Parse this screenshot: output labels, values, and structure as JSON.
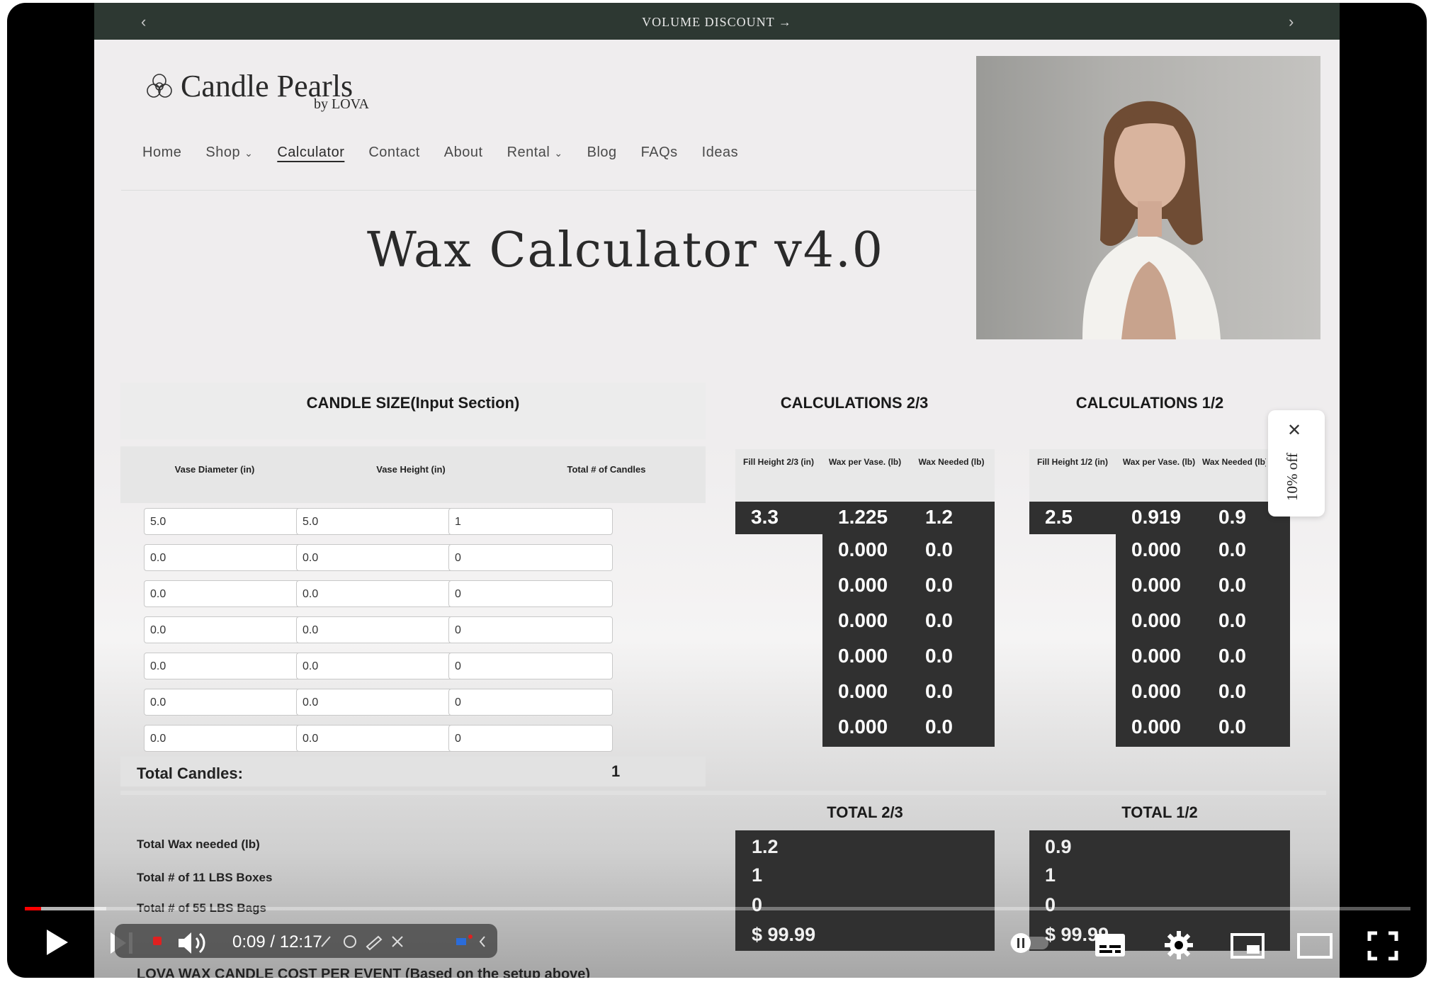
{
  "announcement": {
    "text": "VOLUME DISCOUNT →",
    "prev": "‹",
    "next": "›"
  },
  "logo": {
    "name": "Candle Pearls",
    "by": "by LOVA"
  },
  "nav": [
    {
      "label": "Home",
      "dropdown": false,
      "active": false
    },
    {
      "label": "Shop",
      "dropdown": true,
      "active": false
    },
    {
      "label": "Calculator",
      "dropdown": false,
      "active": true
    },
    {
      "label": "Contact",
      "dropdown": false,
      "active": false
    },
    {
      "label": "About",
      "dropdown": false,
      "active": false
    },
    {
      "label": "Rental",
      "dropdown": true,
      "active": false
    },
    {
      "label": "Blog",
      "dropdown": false,
      "active": false
    },
    {
      "label": "FAQs",
      "dropdown": false,
      "active": false
    },
    {
      "label": "Ideas",
      "dropdown": false,
      "active": false
    }
  ],
  "page_title": "Wax Calculator v4.0",
  "input_section": {
    "heading": "CANDLE SIZE(Input Section)",
    "columns": [
      "Vase Diameter (in)",
      "Vase Height (in)",
      "Total # of Candles"
    ],
    "rows": [
      [
        "5.0",
        "5.0",
        "1"
      ],
      [
        "0.0",
        "0.0",
        "0"
      ],
      [
        "0.0",
        "0.0",
        "0"
      ],
      [
        "0.0",
        "0.0",
        "0"
      ],
      [
        "0.0",
        "0.0",
        "0"
      ],
      [
        "0.0",
        "0.0",
        "0"
      ],
      [
        "0.0",
        "0.0",
        "0"
      ]
    ],
    "total_label": "Total Candles:",
    "total_value": "1"
  },
  "calc_23": {
    "heading": "CALCULATIONS 2/3",
    "columns": [
      "Fill Height 2/3 (in)",
      "Wax per Vase. (lb)",
      "Wax Needed (lb)"
    ],
    "fill_height": "3.3",
    "rows": [
      [
        "1.225",
        "1.2"
      ],
      [
        "0.000",
        "0.0"
      ],
      [
        "0.000",
        "0.0"
      ],
      [
        "0.000",
        "0.0"
      ],
      [
        "0.000",
        "0.0"
      ],
      [
        "0.000",
        "0.0"
      ],
      [
        "0.000",
        "0.0"
      ]
    ]
  },
  "calc_12": {
    "heading": "CALCULATIONS 1/2",
    "columns": [
      "Fill Height 1/2 (in)",
      "Wax per Vase. (lb)",
      "Wax Needed (lb)"
    ],
    "fill_height": "2.5",
    "rows": [
      [
        "0.919",
        "0.9"
      ],
      [
        "0.000",
        "0.0"
      ],
      [
        "0.000",
        "0.0"
      ],
      [
        "0.000",
        "0.0"
      ],
      [
        "0.000",
        "0.0"
      ],
      [
        "0.000",
        "0.0"
      ],
      [
        "0.000",
        "0.0"
      ]
    ]
  },
  "totals": {
    "labels": [
      "Total Wax needed (lb)",
      "Total # of 11 LBS Boxes",
      "Total # of 55 LBS Bags"
    ],
    "t23": {
      "heading": "TOTAL 2/3",
      "values": [
        "1.2",
        "1",
        "0",
        "$ 99.99"
      ]
    },
    "t12": {
      "heading": "TOTAL 1/2",
      "values": [
        "0.9",
        "1",
        "0",
        "$ 99.99"
      ]
    }
  },
  "footer_text": "LOVA WAX CANDLE COST PER EVENT (Based on the setup above)",
  "popup": {
    "close": "✕",
    "label": "10% off"
  },
  "player": {
    "time": "0:09 / 12:17",
    "progress_fraction": 0.012,
    "buffered_fraction": 0.059
  }
}
